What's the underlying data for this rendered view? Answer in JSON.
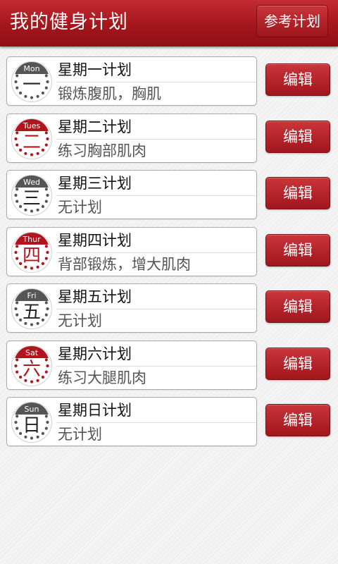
{
  "header": {
    "title": "我的健身计划",
    "reference_button": "参考计划"
  },
  "colors": {
    "header_red": "#a4161c",
    "badge_red": "#b0141c",
    "badge_gray": "#555555"
  },
  "days": [
    {
      "abbr": "Mon",
      "numeral": "一",
      "title": "星期一计划",
      "desc": "锻炼腹肌，胸肌",
      "edit": "编辑",
      "badge_color": "gray"
    },
    {
      "abbr": "Tues",
      "numeral": "二",
      "title": "星期二计划",
      "desc": "练习胸部肌肉",
      "edit": "编辑",
      "badge_color": "red"
    },
    {
      "abbr": "Wed",
      "numeral": "三",
      "title": "星期三计划",
      "desc": "无计划",
      "edit": "编辑",
      "badge_color": "gray"
    },
    {
      "abbr": "Thur",
      "numeral": "四",
      "title": "星期四计划",
      "desc": "背部锻炼，增大肌肉",
      "edit": "编辑",
      "badge_color": "red"
    },
    {
      "abbr": "Fri",
      "numeral": "五",
      "title": "星期五计划",
      "desc": "无计划",
      "edit": "编辑",
      "badge_color": "gray"
    },
    {
      "abbr": "Sat",
      "numeral": "六",
      "title": "星期六计划",
      "desc": "练习大腿肌肉",
      "edit": "编辑",
      "badge_color": "red"
    },
    {
      "abbr": "Sun",
      "numeral": "日",
      "title": "星期日计划",
      "desc": "无计划",
      "edit": "编辑",
      "badge_color": "gray"
    }
  ]
}
